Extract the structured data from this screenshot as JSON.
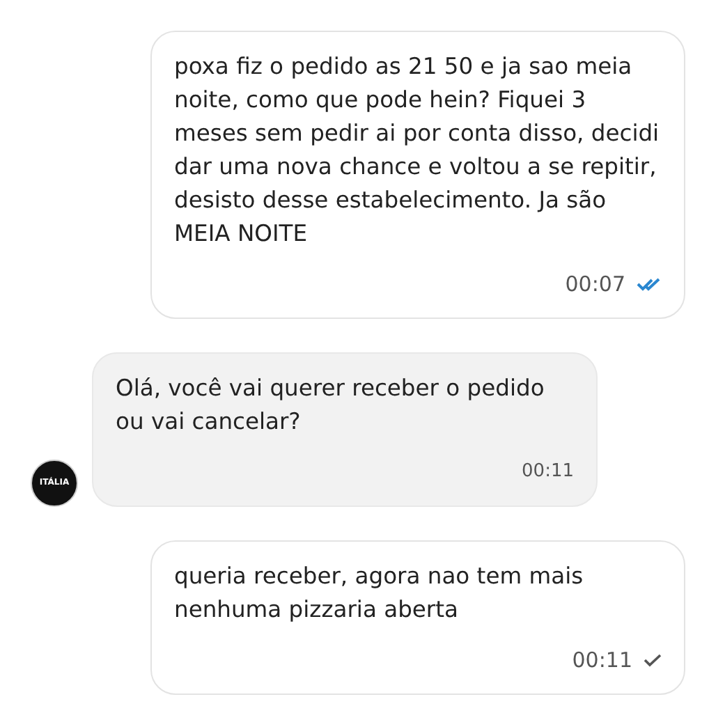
{
  "messages": [
    {
      "kind": "outgoing",
      "text": "poxa fiz o pedido as 21 50 e ja sao meia noite, como que pode hein? Fiquei 3 meses sem pedir ai por conta disso, decidi dar uma nova chance e voltou a se repitir, desisto desse estabelecimento. Ja são MEIA NOITE",
      "time": "00:07",
      "read": true
    },
    {
      "kind": "incoming",
      "text": "Olá, você vai querer receber o pedido ou vai cancelar?",
      "time": "00:11",
      "avatar_text": "ITÁLIA"
    },
    {
      "kind": "outgoing",
      "text": "queria receber, agora nao tem mais nenhuma pizzaria aberta",
      "time": "00:11",
      "read": false
    }
  ]
}
